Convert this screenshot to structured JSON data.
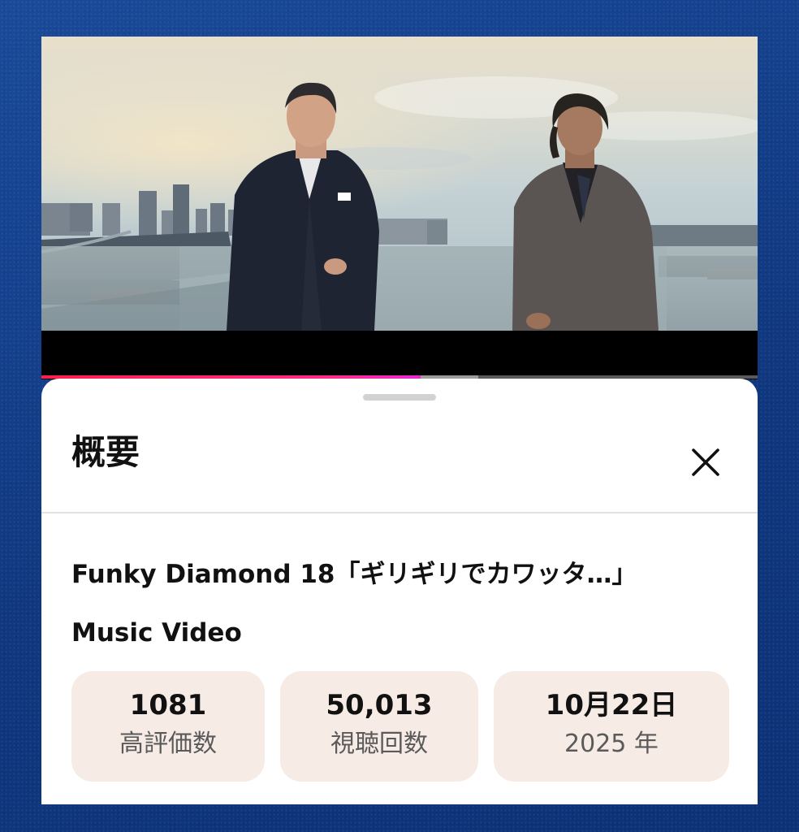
{
  "player": {
    "progress_played": 0.53,
    "progress_buffered": 0.61,
    "progress_color": "#ff1f4b"
  },
  "sheet": {
    "title": "概要",
    "close_icon": "close-icon"
  },
  "video": {
    "title_line1": "Funky Diamond 18「ギリギリでカワッタ…」",
    "title_line2": "Music Video"
  },
  "stats": [
    {
      "value": "1081",
      "label": "高評価数"
    },
    {
      "value": "50,013",
      "label": "視聴回数"
    },
    {
      "value": "10月22日",
      "label": "2025 年"
    }
  ],
  "colors": {
    "page_background": "#123f8c",
    "sheet_background": "#ffffff",
    "stat_card_background": "#f6ebe5"
  }
}
